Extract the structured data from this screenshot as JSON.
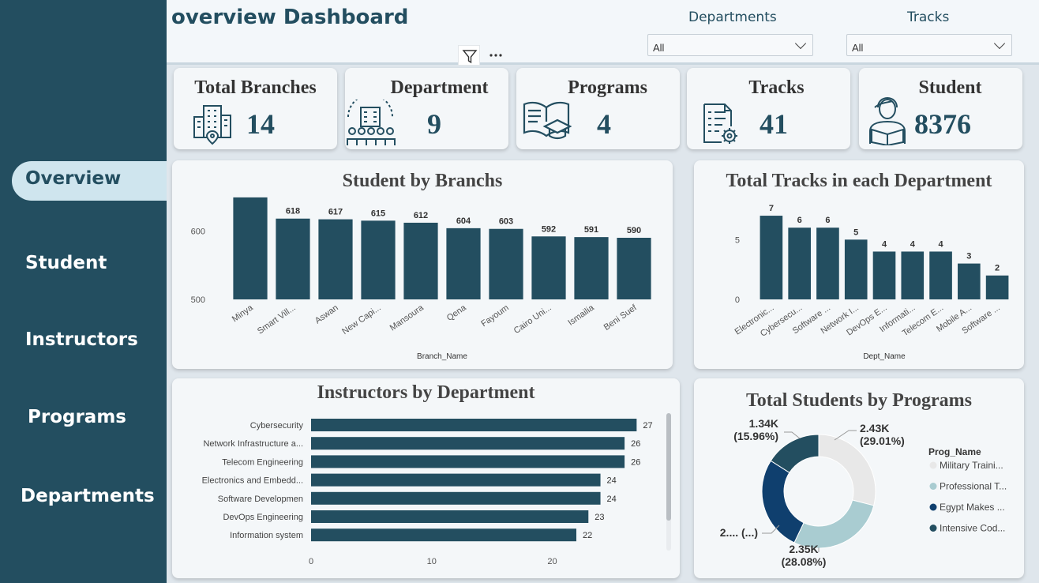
{
  "sidebar": {
    "items": [
      {
        "label": "Overview",
        "active": true
      },
      {
        "label": "Student"
      },
      {
        "label": "Instructors"
      },
      {
        "label": "Programs"
      },
      {
        "label": "Departments"
      }
    ]
  },
  "header": {
    "title": "overview Dashboard",
    "slicers": [
      {
        "label": "Departments",
        "value": "All"
      },
      {
        "label": "Tracks",
        "value": "All"
      }
    ]
  },
  "kpis": [
    {
      "title": "Total Branches",
      "value": "14",
      "icon": "building-location-icon"
    },
    {
      "title": "Department",
      "value": "9",
      "icon": "department-people-icon"
    },
    {
      "title": "Programs",
      "value": "4",
      "icon": "book-graduation-icon"
    },
    {
      "title": "Tracks",
      "value": "41",
      "icon": "checklist-gear-icon"
    },
    {
      "title": "Student",
      "value": "8376",
      "icon": "student-reading-icon"
    }
  ],
  "colors": {
    "bar": "#234e60",
    "sidebar": "#234e60",
    "pie": [
      "#e8e8e8",
      "#a9ccd1",
      "#0f3f6e",
      "#234e60"
    ]
  },
  "chart_data": [
    {
      "type": "bar",
      "title": "Student by Branchs",
      "xlabel": "Branch_Name",
      "ylabel": "",
      "categories": [
        "Minya",
        "Smart Vill...",
        "Aswan",
        "New Capi...",
        "Mansoura",
        "Qena",
        "Fayoum",
        "Cairo Uni...",
        "Ismailia",
        "Beni Suef"
      ],
      "values": [
        649,
        618,
        617,
        615,
        612,
        604,
        603,
        592,
        591,
        590
      ],
      "data_labels": [
        "",
        "618",
        "617",
        "615",
        "612",
        "604",
        "603",
        "592",
        "591",
        "590"
      ],
      "yticks": [
        "500",
        "600"
      ],
      "ylim": [
        500,
        650
      ]
    },
    {
      "type": "bar",
      "title": "Total Tracks in each Department",
      "xlabel": "Dept_Name",
      "ylabel": "",
      "categories": [
        "Electronic...",
        "Cybersecu...",
        "Software ...",
        "Network I...",
        "DevOps E...",
        "Informati...",
        "Telecom E...",
        "Mobile A...",
        "Software ..."
      ],
      "values": [
        7,
        6,
        6,
        5,
        4,
        4,
        4,
        3,
        2
      ],
      "data_labels": [
        "7",
        "6",
        "6",
        "5",
        "4",
        "4",
        "4",
        "3",
        "2"
      ],
      "yticks": [
        "0",
        "5"
      ],
      "ylim": [
        0,
        7.4
      ]
    },
    {
      "type": "bar",
      "orientation": "horizontal",
      "title": "Instructors by Department",
      "categories": [
        "Cybersecurity",
        "Network Infrastructure a...",
        "Telecom Engineering",
        "Electronics and Embedd...",
        "Software Developmen",
        "DevOps Engineering",
        "Information system"
      ],
      "values": [
        27,
        26,
        26,
        24,
        24,
        23,
        22
      ],
      "data_labels": [
        "27",
        "26",
        "26",
        "24",
        "24",
        "23",
        "22"
      ],
      "xticks": [
        "0",
        "10",
        "20"
      ],
      "xlim": [
        0,
        27.5
      ]
    },
    {
      "type": "pie",
      "title": "Total Students by Programs",
      "legend_title": "Prog_Name",
      "legend": [
        "Military Traini...",
        "Professional T...",
        "Egypt Makes ...",
        "Intensive Cod..."
      ],
      "values": [
        29.01,
        28.08,
        26.95,
        15.96
      ],
      "data_labels": [
        [
          "2.43K",
          "(29.01%)"
        ],
        [
          "2.35K",
          "(28.08%)"
        ],
        [
          "2.... (...)",
          ""
        ],
        [
          "1.34K",
          "(15.96%)"
        ]
      ]
    }
  ]
}
